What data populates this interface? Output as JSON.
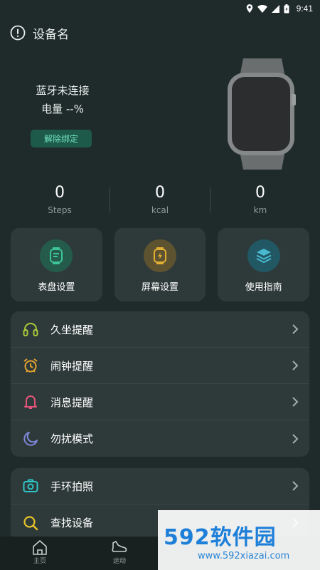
{
  "status_bar": {
    "time": "9:41"
  },
  "header": {
    "title": "设备名"
  },
  "device": {
    "connection": "蓝牙未连接",
    "battery": "电量 --%",
    "unbind_label": "解除绑定"
  },
  "stats": [
    {
      "value": "0",
      "label": "Steps"
    },
    {
      "value": "0",
      "label": "kcal"
    },
    {
      "value": "0",
      "label": "km"
    }
  ],
  "quick_cards": [
    {
      "label": "表盘设置",
      "icon": "watch-face-icon",
      "color": "#3ec49a"
    },
    {
      "label": "屏幕设置",
      "icon": "screen-icon",
      "color": "#e0b034"
    },
    {
      "label": "使用指南",
      "icon": "layers-icon",
      "color": "#48b9cf"
    }
  ],
  "reminders": [
    {
      "label": "久坐提醒",
      "icon": "headphones-icon",
      "color": "#a9c83a"
    },
    {
      "label": "闹钟提醒",
      "icon": "alarm-clock-icon",
      "color": "#e3a130"
    },
    {
      "label": "消息提醒",
      "icon": "bell-icon",
      "color": "#e2557a"
    },
    {
      "label": "勿扰模式",
      "icon": "moon-icon",
      "color": "#7f87d9"
    }
  ],
  "tools": [
    {
      "label": "手环拍照",
      "icon": "camera-icon",
      "color": "#2fc4c7"
    },
    {
      "label": "查找设备",
      "icon": "search-icon",
      "color": "#e6c12a"
    }
  ],
  "bottom_nav": [
    {
      "label": "主页",
      "icon": "home-icon"
    },
    {
      "label": "运动",
      "icon": "shoe-icon"
    }
  ],
  "watermark": {
    "title": "592软件园",
    "url": "www.592xiazai.com"
  }
}
